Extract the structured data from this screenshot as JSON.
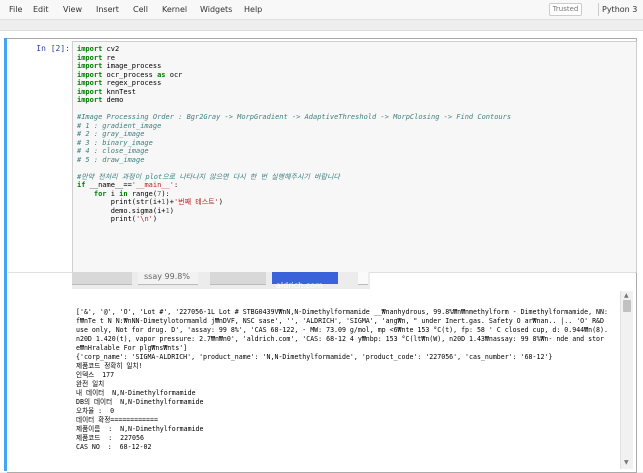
{
  "menu": [
    "File",
    "Edit",
    "View",
    "Insert",
    "Cell",
    "Kernel",
    "Widgets",
    "Help"
  ],
  "trusted": "Trusted",
  "kernel": "Python 3",
  "prompt": "In [2]:",
  "code": [
    {
      "t": "kw",
      "v": "import"
    },
    {
      "t": "txt",
      "v": " cv2"
    },
    {
      "t": "br"
    },
    {
      "t": "kw",
      "v": "import"
    },
    {
      "t": "txt",
      "v": " re"
    },
    {
      "t": "br"
    },
    {
      "t": "kw",
      "v": "import"
    },
    {
      "t": "txt",
      "v": " image_process"
    },
    {
      "t": "br"
    },
    {
      "t": "kw",
      "v": "import"
    },
    {
      "t": "txt",
      "v": " ocr_process "
    },
    {
      "t": "kw",
      "v": "as"
    },
    {
      "t": "txt",
      "v": " ocr"
    },
    {
      "t": "br"
    },
    {
      "t": "kw",
      "v": "import"
    },
    {
      "t": "txt",
      "v": " regex_process"
    },
    {
      "t": "br"
    },
    {
      "t": "kw",
      "v": "import"
    },
    {
      "t": "txt",
      "v": " knnTest"
    },
    {
      "t": "br"
    },
    {
      "t": "kw",
      "v": "import"
    },
    {
      "t": "txt",
      "v": " demo"
    },
    {
      "t": "br"
    },
    {
      "t": "br"
    },
    {
      "t": "cm",
      "v": "#Image Processing Order : Bgr2Gray -> MorpGradient -> AdaptiveThreshold -> MorpClosing -> Find Contours"
    },
    {
      "t": "br"
    },
    {
      "t": "cm",
      "v": "# 1 : gradient_image"
    },
    {
      "t": "br"
    },
    {
      "t": "cm",
      "v": "# 2 : gray_image"
    },
    {
      "t": "br"
    },
    {
      "t": "cm",
      "v": "# 3 : binary_image"
    },
    {
      "t": "br"
    },
    {
      "t": "cm",
      "v": "# 4 : close_image"
    },
    {
      "t": "br"
    },
    {
      "t": "cm",
      "v": "# 5 : draw_image"
    },
    {
      "t": "br"
    },
    {
      "t": "br"
    },
    {
      "t": "cm",
      "v": "#만약 전처리 과정이 plot으로 나타나지 않으면 다시 한 번 실행해주시기 바랍니다"
    },
    {
      "t": "br"
    },
    {
      "t": "kw",
      "v": "if"
    },
    {
      "t": "txt",
      "v": " __name__=="
    },
    {
      "t": "st",
      "v": "'__main__'"
    },
    {
      "t": "txt",
      "v": ":"
    },
    {
      "t": "br"
    },
    {
      "t": "txt",
      "v": "    "
    },
    {
      "t": "kw",
      "v": "for"
    },
    {
      "t": "txt",
      "v": " i "
    },
    {
      "t": "kw",
      "v": "in"
    },
    {
      "t": "txt",
      "v": " range("
    },
    {
      "t": "nm",
      "v": "7"
    },
    {
      "t": "txt",
      "v": "):"
    },
    {
      "t": "br"
    },
    {
      "t": "txt",
      "v": "        print(str(i+"
    },
    {
      "t": "nm",
      "v": "1"
    },
    {
      "t": "txt",
      "v": ")+"
    },
    {
      "t": "st",
      "v": "'번째 테스트'"
    },
    {
      "t": "txt",
      "v": ")"
    },
    {
      "t": "br"
    },
    {
      "t": "txt",
      "v": "        demo.sigma(i+"
    },
    {
      "t": "nm",
      "v": "1"
    },
    {
      "t": "txt",
      "v": ")"
    },
    {
      "t": "br"
    },
    {
      "t": "txt",
      "v": "        print("
    },
    {
      "t": "st",
      "v": "'\\n'"
    },
    {
      "t": "txt",
      "v": ")"
    }
  ],
  "strip": {
    "a": "ssay 99.8%",
    "b": "aldrich.com"
  },
  "output": [
    "['&', '@', 'O', 'Lot #', '227056-1L Lot # STBG0439V₩nN,N-Dimethylformamide __₩nanhydrous, 99.8%₩n₩nmethylform - Dimethylformamide, NN:",
    "f₩nTe t N N:₩nNN-Dimetylotormamld j₩nDVF, NSC sase', '', 'ALDRICH', 'SIGMA', 'ang₩n, \" under Inert.gas. Safety O ar₩nan.. |.. 'O' R&D",
    "use only, Not for drug. D', 'assay: 99 8%', 'CAS 68-122, - MW: 73.09 g/mol, mp <6₩nte 153 °C(t), fp: 58 ' C closed cup, d: 0.944₩n(8).",
    "n20D 1.420(t), vapor pressure: 2.7₩n₩n0', 'aldrich.com', 'CAS: 68-12 4 y₩nbp: 153 °C(lt₩n(W), n20D 1.43₩nassay: 99 8%₩n- nde and stor",
    "e₩nHralable For plg₩ns₩nts']",
    "{'corp_name': 'SIGMA-ALDRICH', 'product_name': 'N,N-Dimethylformamide', 'product_code': '227056', 'cas_number': '68-12'}",
    "제품코드 정확히 일치!",
    "인덱스  177",
    "완전 일치",
    "내 데이터  N,N-Dimethylformamide",
    "DB의 데이터  N,N-Dimethylformamide",
    "오차율 :  0",
    "데이터 확정============",
    "제품이름  :  N,N-Dimethylformamide",
    "제품코드  :  227056",
    "CAS NO  :  68-12-02"
  ]
}
